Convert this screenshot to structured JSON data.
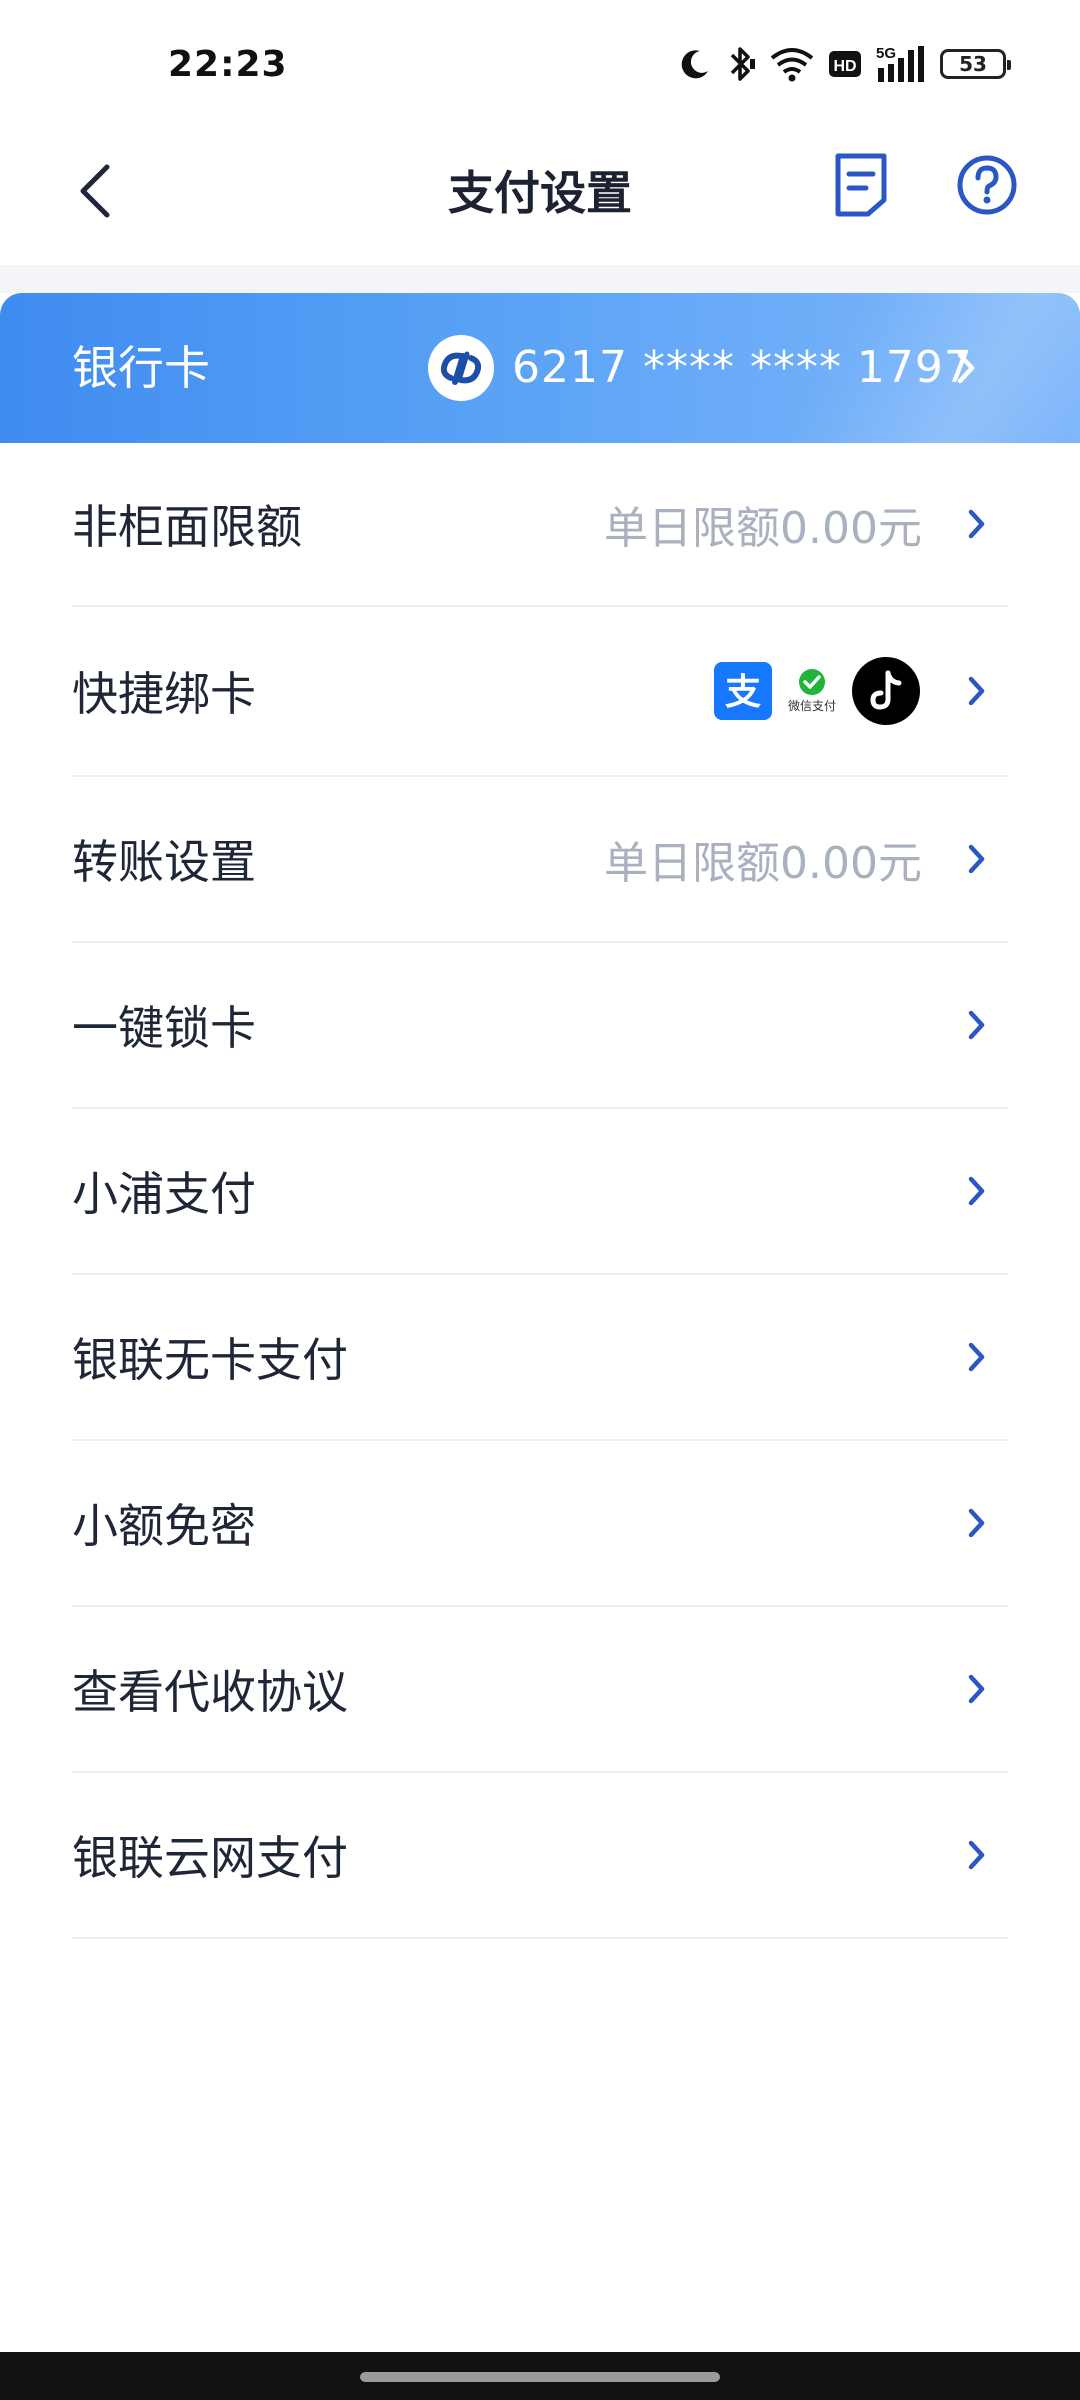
{
  "status_bar": {
    "time": "22:23",
    "battery": "53",
    "icons": [
      "moon-icon",
      "bluetooth-icon",
      "wifi-icon",
      "hd-icon",
      "signal-5g-icon",
      "battery-icon"
    ]
  },
  "header": {
    "title": "支付设置",
    "icons": [
      "back-arrow-icon",
      "document-icon",
      "help-icon"
    ]
  },
  "bank_card": {
    "label": "银行卡",
    "card_number": "6217 **** **** 1797",
    "logo_icon": "spdb-bank-logo-icon"
  },
  "settings": [
    {
      "label": "非柜面限额",
      "value": "单日限额0.00元"
    },
    {
      "label": "快捷绑卡",
      "value": "",
      "icons": [
        "alipay-icon",
        "wechat-pay-icon",
        "douyin-icon"
      ],
      "wechat_pay_text": "微信支付"
    },
    {
      "label": "转账设置",
      "value": "单日限额0.00元"
    },
    {
      "label": "一键锁卡",
      "value": ""
    },
    {
      "label": "小浦支付",
      "value": ""
    },
    {
      "label": "银联无卡支付",
      "value": ""
    },
    {
      "label": "小额免密",
      "value": ""
    },
    {
      "label": "查看代收协议",
      "value": ""
    },
    {
      "label": "银联云网支付",
      "value": ""
    }
  ],
  "colors": {
    "accent": "#2a56c6",
    "banner_start": "#3f8cf0",
    "banner_end": "#7fb7fa",
    "muted_value": "#a9b0bf"
  }
}
